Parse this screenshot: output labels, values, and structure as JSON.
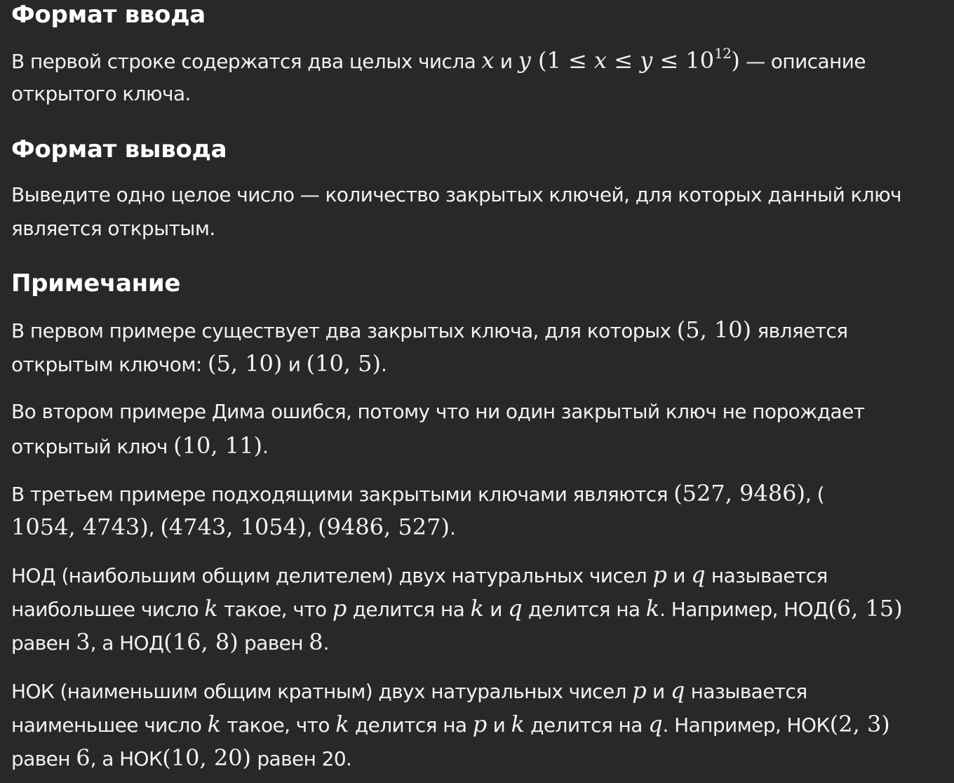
{
  "input_format": {
    "heading": "Формат ввода",
    "t1": "В первой строке содержатся два целых числа ",
    "x": "x",
    "and": " и ",
    "y": "y",
    "cond_a": " (1 ≤ ",
    "cond_b": " ≤ ",
    "cond_c": " ≤ 10",
    "exp": "12",
    "cond_d": ")",
    "t2": " — описание",
    "t3": "открытого ключа."
  },
  "output_format": {
    "heading": "Формат вывода",
    "t1": "Выведите одно целое число — количество закрытых ключей, для которых данный ключ",
    "t2": "является открытым."
  },
  "note": {
    "heading": "Примечание",
    "p1": {
      "t1": "В первом примере существует два закрытых ключа, для которых ",
      "m1": "(5, 10)",
      "t2": " является",
      "t3": "открытым ключом: ",
      "m2": "(5, 10)",
      "t4": " и ",
      "m3": "(10, 5)",
      "t5": "."
    },
    "p2": {
      "t1": "Во втором примере Дима ошибся, потому что ни один закрытый ключ не порождает",
      "t2": "открытый ключ ",
      "m1": "(10, 11)",
      "t3": "."
    },
    "p3": {
      "t1": "В третьем примере подходящими закрытыми ключами являются ",
      "m1": "(527, 9486)",
      "t2": ", (",
      "m2": "1054, 4743)",
      "t3": ", ",
      "m3": "(4743, 1054)",
      "t4": ", ",
      "m4": "(9486, 527)",
      "t5": "."
    },
    "p4": {
      "t1": "НОД (наибольшим общим делителем) двух натуральных чисел ",
      "v_p": "p",
      "v_q": "q",
      "v_k": "k",
      "and": " и ",
      "t2": " называется",
      "t3": "наибольшее число ",
      "t4": " такое, что ",
      "t5": " делится на ",
      "t6": ". Например, НОД",
      "m1": "(6, 15)",
      "t7": "равен ",
      "m2": "3",
      "t8": ", а НОД",
      "m3": "(16, 8)",
      "t9": " равен ",
      "m4": "8",
      "t10": "."
    },
    "p5": {
      "t1": "НОК (наименьшим общим кратным) двух натуральных чисел ",
      "v_p": "p",
      "v_q": "q",
      "v_k": "k",
      "and": " и ",
      "t2": " называется",
      "t3": "наименьшее число ",
      "t4": " такое, что ",
      "t5": " делится на ",
      "t6": ". Например, НОК",
      "m1": "(2, 3)",
      "t7": "равен ",
      "m2": "6",
      "t8": ", а НОК",
      "m3": "(10, 20)",
      "t9": " равен 20."
    }
  }
}
